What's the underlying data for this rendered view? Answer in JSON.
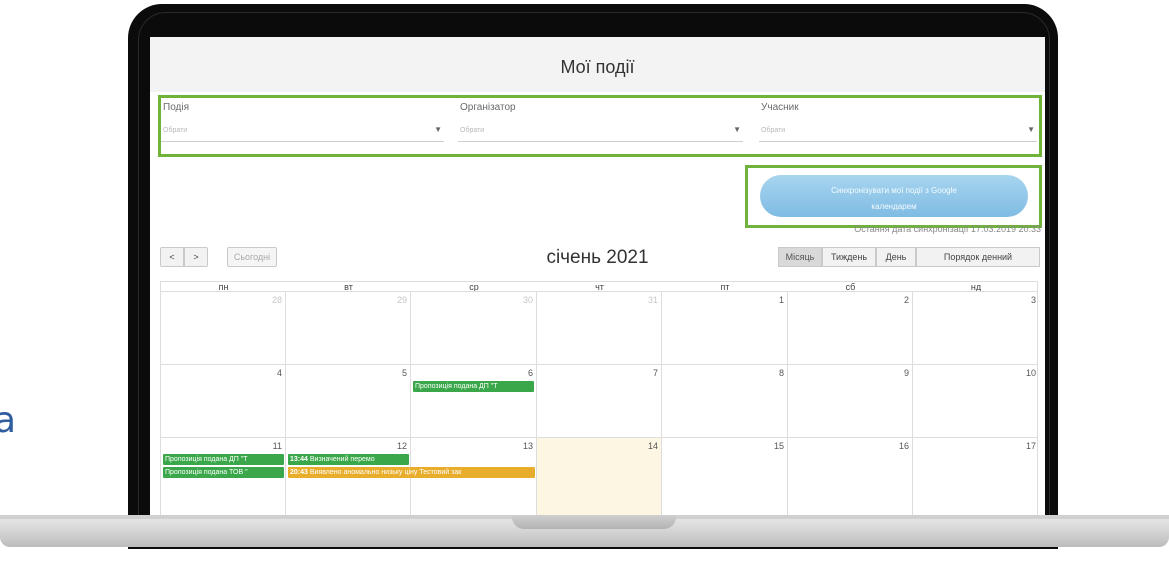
{
  "side_letter": "a",
  "app": {
    "title": "Мої події"
  },
  "filters": [
    {
      "label": "Подія",
      "placeholder": "Обрати"
    },
    {
      "label": "Організатор",
      "placeholder": "Обрати"
    },
    {
      "label": "Учасник",
      "placeholder": "Обрати"
    }
  ],
  "sync": {
    "button_line1": "Синхронізувати мої події з Google",
    "button_line2": "календарем",
    "last_sync": "Остання дата синхронізації 17.03.2019 20:33"
  },
  "calendar": {
    "title": "січень 2021",
    "nav": {
      "prev": "<",
      "next": ">",
      "today": "Сьогодні"
    },
    "views": [
      "Місяць",
      "Тиждень",
      "День",
      "Порядок денний"
    ],
    "active_view": "Місяць",
    "weekdays": [
      "пн",
      "вт",
      "ср",
      "чт",
      "пт",
      "сб",
      "нд"
    ],
    "weeks": [
      [
        "28",
        "29",
        "30",
        "31",
        "1",
        "2",
        "3"
      ],
      [
        "4",
        "5",
        "6",
        "7",
        "8",
        "9",
        "10"
      ],
      [
        "11",
        "12",
        "13",
        "14",
        "15",
        "16",
        "17"
      ]
    ],
    "today": "14",
    "events": {
      "week2_wed": "Пропозиція подана ДП \"Т",
      "week3_mon_1": "Пропозиція подана ДП \"Т",
      "week3_mon_2": "Пропозиція подана ТОВ \"",
      "week3_tue_1_time": "13:44",
      "week3_tue_1_text": "Визначений перемо",
      "week3_tue_2_time": "20:43",
      "week3_tue_2_text": "Виявлено аномально низьку ціну Тестовий зак"
    },
    "colors": {
      "green": "#3aa84a",
      "orange": "#e9ad2c",
      "today_bg": "#fcf6e3",
      "highlight": "#6fb33a"
    }
  }
}
